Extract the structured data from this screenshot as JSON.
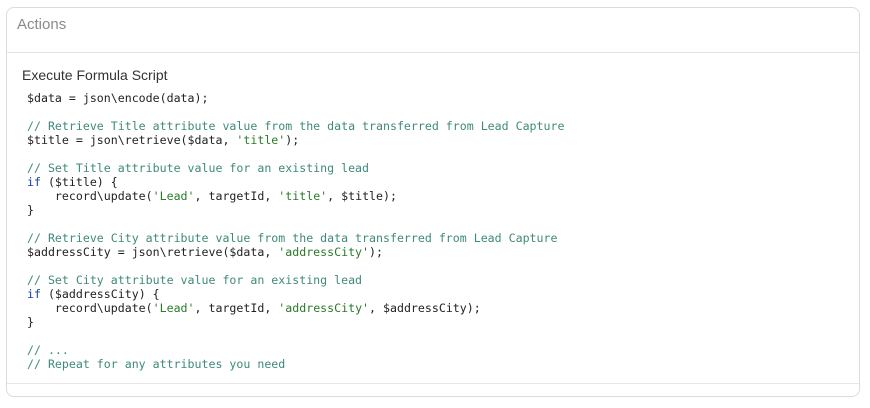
{
  "panel": {
    "title": "Actions"
  },
  "action": {
    "label": "Execute Formula Script"
  },
  "script": {
    "lines": [
      [
        {
          "t": "$data = json\\encode(data);",
          "c": ""
        }
      ],
      [],
      [
        {
          "t": "// Retrieve Title attribute value from the data transferred from Lead Capture",
          "c": "c"
        }
      ],
      [
        {
          "t": "$title = json\\retrieve($data, ",
          "c": ""
        },
        {
          "t": "'title'",
          "c": "s"
        },
        {
          "t": ");",
          "c": ""
        }
      ],
      [],
      [
        {
          "t": "// Set Title attribute value for an existing lead",
          "c": "c"
        }
      ],
      [
        {
          "t": "if",
          "c": "k"
        },
        {
          "t": " ($title) {",
          "c": ""
        }
      ],
      [
        {
          "t": "    record\\update(",
          "c": ""
        },
        {
          "t": "'Lead'",
          "c": "s"
        },
        {
          "t": ", targetId, ",
          "c": ""
        },
        {
          "t": "'title'",
          "c": "s"
        },
        {
          "t": ", $title);",
          "c": ""
        }
      ],
      [
        {
          "t": "}",
          "c": ""
        }
      ],
      [],
      [
        {
          "t": "// Retrieve City attribute value from the data transferred from Lead Capture",
          "c": "c"
        }
      ],
      [
        {
          "t": "$addressCity = json\\retrieve($data, ",
          "c": ""
        },
        {
          "t": "'addressCity'",
          "c": "s"
        },
        {
          "t": ");",
          "c": ""
        }
      ],
      [],
      [
        {
          "t": "// Set City attribute value for an existing lead",
          "c": "c"
        }
      ],
      [
        {
          "t": "if",
          "c": "k"
        },
        {
          "t": " ($addressCity) {",
          "c": ""
        }
      ],
      [
        {
          "t": "    record\\update(",
          "c": ""
        },
        {
          "t": "'Lead'",
          "c": "s"
        },
        {
          "t": ", targetId, ",
          "c": ""
        },
        {
          "t": "'addressCity'",
          "c": "s"
        },
        {
          "t": ", $addressCity);",
          "c": ""
        }
      ],
      [
        {
          "t": "}",
          "c": ""
        }
      ],
      [],
      [
        {
          "t": "// ...",
          "c": "c"
        }
      ],
      [
        {
          "t": "// Repeat for any attributes you need",
          "c": "c"
        }
      ]
    ]
  }
}
